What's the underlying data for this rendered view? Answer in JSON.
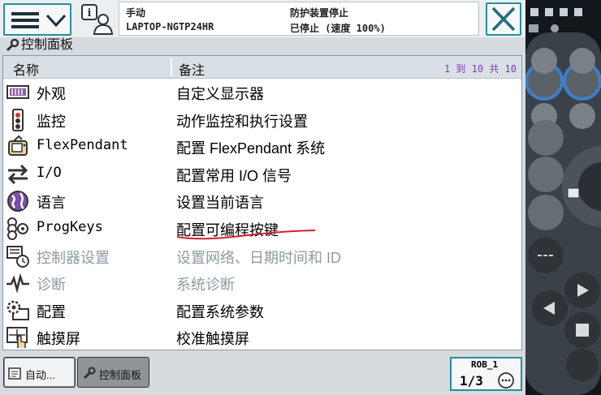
{
  "header": {
    "mode": "手动",
    "system": "LAPTOP-NGTP24HR",
    "guard_status": "防护装置停止",
    "run_status": "已停止 (速度 100%)"
  },
  "panel": {
    "title": "控制面板"
  },
  "table": {
    "col_name": "名称",
    "col_note": "备注",
    "count": "1 到 10 共 10",
    "rows": [
      {
        "name": "外观",
        "desc": "自定义显示器",
        "icon": "appearance-icon",
        "enabled": true
      },
      {
        "name": "监控",
        "desc": "动作监控和执行设置",
        "icon": "supervision-icon",
        "enabled": true
      },
      {
        "name": "FlexPendant",
        "desc": "配置 FlexPendant 系统",
        "icon": "flexpendant-icon",
        "enabled": true
      },
      {
        "name": "I/O",
        "desc": "配置常用 I/O 信号",
        "icon": "io-icon",
        "enabled": true
      },
      {
        "name": "语言",
        "desc": "设置当前语言",
        "icon": "language-icon",
        "enabled": true
      },
      {
        "name": "ProgKeys",
        "desc": "配置可编程按键",
        "icon": "progkeys-icon",
        "enabled": true
      },
      {
        "name": "控制器设置",
        "desc": "设置网络、日期时间和 ID",
        "icon": "controller-settings-icon",
        "enabled": false
      },
      {
        "name": "诊断",
        "desc": "系统诊断",
        "icon": "diagnostics-icon",
        "enabled": false
      },
      {
        "name": "配置",
        "desc": "配置系统参数",
        "icon": "configuration-icon",
        "enabled": true
      },
      {
        "name": "触摸屏",
        "desc": "校准触摸屏",
        "icon": "touchscreen-icon",
        "enabled": true
      }
    ]
  },
  "taskbar": {
    "auto_label": "自动...",
    "cp_label": "控制面板",
    "rob_label": "ROB_1",
    "rob_fraction": "1/3"
  },
  "colors": {
    "accent": "#2a8d9a",
    "count_text": "#7b3fb0",
    "disabled_text": "#8f9aa3",
    "annotation_red": "#d4202a"
  }
}
